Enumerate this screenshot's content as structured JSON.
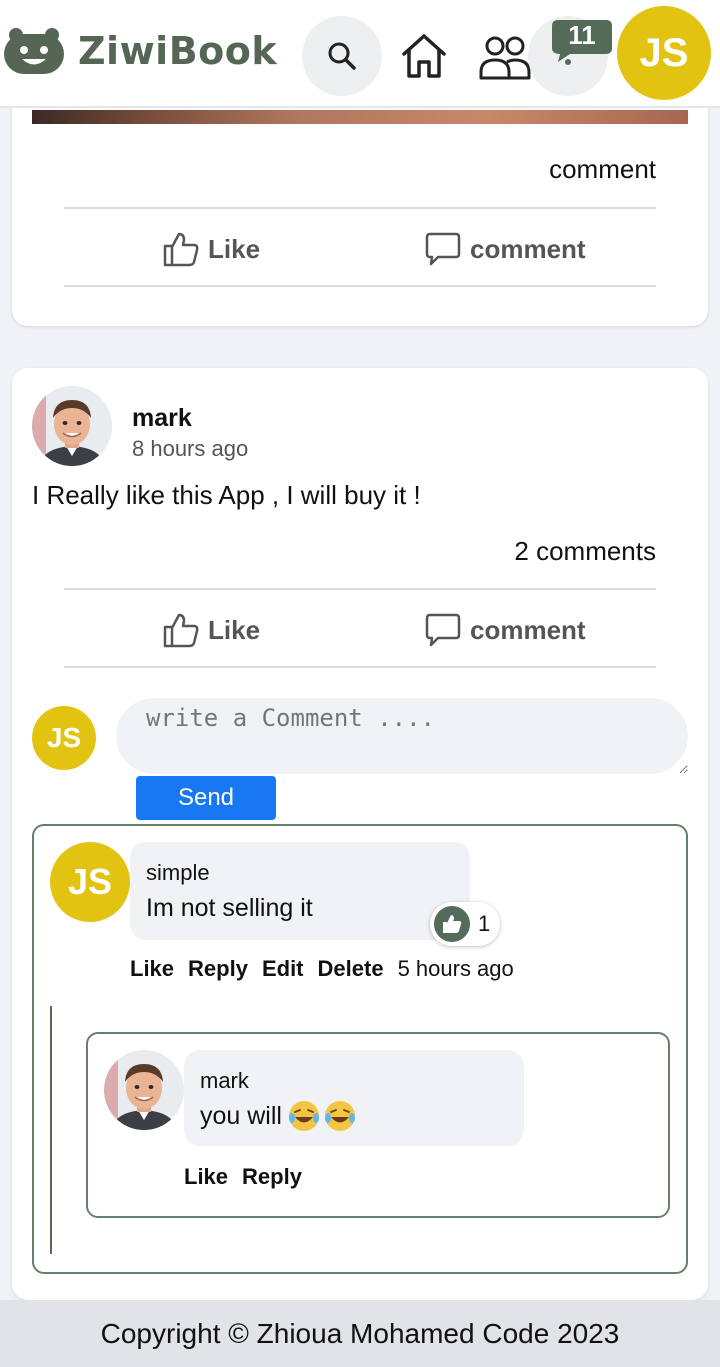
{
  "header": {
    "brand": "ZiwiBook",
    "notification_count": "11",
    "user_initials": "JS"
  },
  "post_prev": {
    "comments_count": "comment",
    "like_label": "Like",
    "comment_label": "comment"
  },
  "post": {
    "author": "mark",
    "time": "8 hours ago",
    "text": "I Really like this App , I will buy it !",
    "comments_count": "2 comments",
    "like_label": "Like",
    "comment_label": "comment",
    "composer": {
      "initials": "JS",
      "placeholder": "write a Comment ....",
      "send_label": "Send"
    },
    "comments": [
      {
        "initials": "JS",
        "author": "simple",
        "text": "Im not selling it",
        "reaction_count": "1",
        "actions": {
          "like": "Like",
          "reply": "Reply",
          "edit": "Edit",
          "delete": "Delete",
          "time": "5 hours ago"
        },
        "replies": [
          {
            "author": "mark",
            "text": "you will",
            "actions": {
              "like": "Like",
              "reply": "Reply"
            }
          }
        ]
      }
    ]
  },
  "footer": {
    "text": "Copyright © Zhioua Mohamed Code 2023"
  },
  "colors": {
    "brand": "#556655",
    "accent_yellow": "#e3c312",
    "send_blue": "#1877f2",
    "thread_border": "#66806a"
  }
}
